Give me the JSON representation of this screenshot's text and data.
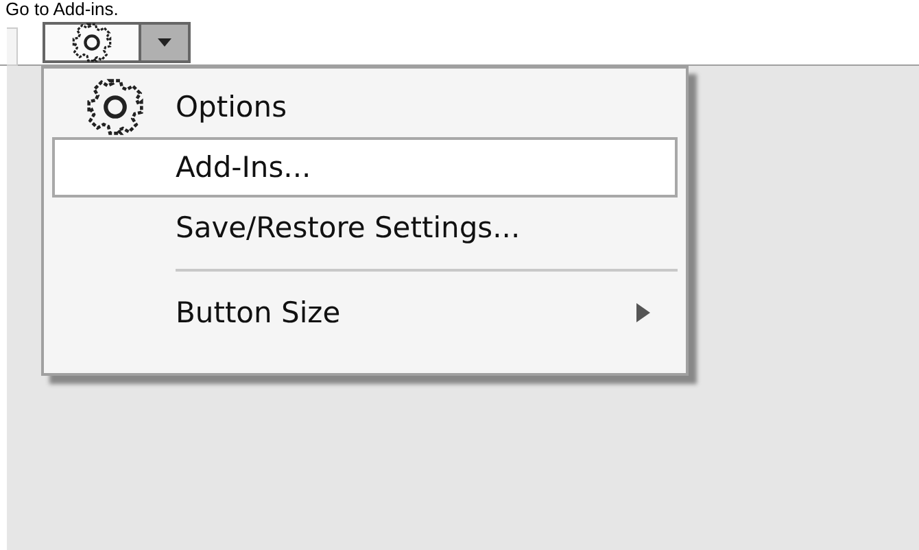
{
  "caption": "Go to Add-ins.",
  "settings_button": {
    "dropdown_open": true
  },
  "menu": {
    "items": [
      {
        "kind": "icon_command",
        "label": "Options",
        "selected": false
      },
      {
        "kind": "command",
        "label": "Add-Ins...",
        "selected": true
      },
      {
        "kind": "command",
        "label": "Save/Restore Settings...",
        "selected": false
      },
      {
        "kind": "separator"
      },
      {
        "kind": "submenu",
        "label": "Button Size",
        "selected": false
      }
    ]
  }
}
